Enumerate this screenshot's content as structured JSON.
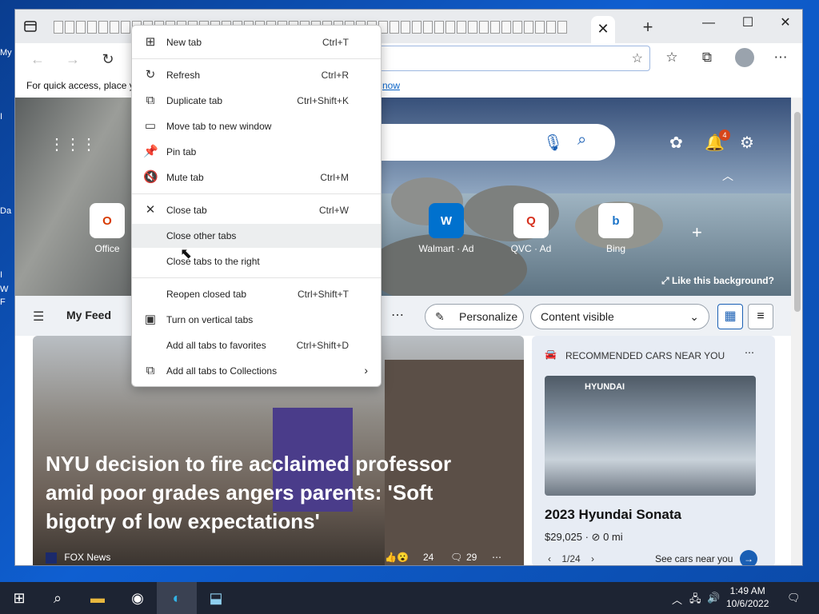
{
  "desktop": {
    "labels": [
      "My",
      "I",
      "Da",
      "I",
      "W",
      "F"
    ]
  },
  "window": {
    "tab_close": "✕",
    "new_tab": "+",
    "controls": {
      "minimize": "—",
      "maximize": "☐",
      "close": "✕"
    }
  },
  "toolbar": {
    "back": "←",
    "forward": "→",
    "refresh": "↻"
  },
  "favbar": {
    "message": "For quick access, place y",
    "link": "now"
  },
  "ntp": {
    "tiles": [
      {
        "label": "Office",
        "glyph": "O",
        "color": "#d83b01"
      },
      {
        "label": "Walmart · Ad",
        "glyph": "W",
        "color": "#0071ce"
      },
      {
        "label": "QVC · Ad",
        "glyph": "Q",
        "color": "#d6311f"
      },
      {
        "label": "Bing",
        "glyph": "b",
        "color": "#1a73c8"
      }
    ],
    "notification_count": "4",
    "like_background": "Like this background?",
    "feed": {
      "title": "My Feed",
      "personalize": "Personalize",
      "content_visible": "Content visible"
    },
    "news": {
      "headline": "NYU decision to fire acclaimed professor amid poor grades angers parents: 'Soft bigotry of low expectations'",
      "source": "FOX News",
      "reactions": "24",
      "comments": "29"
    },
    "car_card": {
      "header": "RECOMMENDED CARS NEAR YOU",
      "model": "2023 Hyundai Sonata",
      "price": "$29,025 · ",
      "mileage": "0 mi",
      "pager": "1/24",
      "see_more": "See cars near you",
      "brand": "HYUNDAI"
    }
  },
  "context_menu": {
    "items": [
      {
        "label": "New tab",
        "shortcut": "Ctrl+T",
        "icon": "new-tab-icon"
      },
      {
        "label": "Refresh",
        "shortcut": "Ctrl+R",
        "icon": "refresh-icon"
      },
      {
        "label": "Duplicate tab",
        "shortcut": "Ctrl+Shift+K",
        "icon": "duplicate-icon"
      },
      {
        "label": "Move tab to new window",
        "shortcut": "",
        "icon": "window-icon"
      },
      {
        "label": "Pin tab",
        "shortcut": "",
        "icon": "pin-icon"
      },
      {
        "label": "Mute tab",
        "shortcut": "Ctrl+M",
        "icon": "mute-icon"
      },
      {
        "label": "Close tab",
        "shortcut": "Ctrl+W",
        "icon": "close-icon"
      },
      {
        "label": "Close other tabs",
        "shortcut": "",
        "icon": ""
      },
      {
        "label": "Close tabs to the right",
        "shortcut": "",
        "icon": ""
      },
      {
        "label": "Reopen closed tab",
        "shortcut": "Ctrl+Shift+T",
        "icon": ""
      },
      {
        "label": "Turn on vertical tabs",
        "shortcut": "",
        "icon": "vertical-tabs-icon"
      },
      {
        "label": "Add all tabs to favorites",
        "shortcut": "Ctrl+Shift+D",
        "icon": ""
      },
      {
        "label": "Add all tabs to Collections",
        "shortcut": "",
        "icon": "collections-icon"
      }
    ]
  },
  "taskbar": {
    "time": "1:49 AM",
    "date": "10/6/2022"
  }
}
